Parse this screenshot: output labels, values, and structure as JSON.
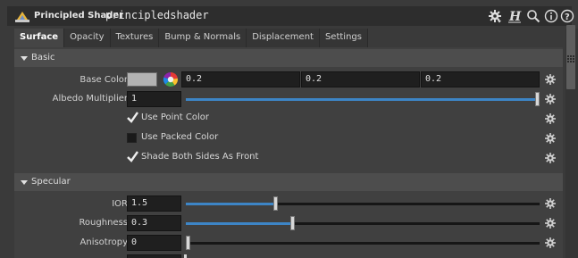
{
  "header": {
    "node_type": "Principled Shader",
    "node_name": "principledshader",
    "icons": [
      "shader-logo-icon",
      "gear-icon",
      "help-h-icon",
      "search-icon",
      "info-icon",
      "question-icon"
    ]
  },
  "tabs": [
    {
      "label": "Surface",
      "active": true
    },
    {
      "label": "Opacity",
      "active": false
    },
    {
      "label": "Textures",
      "active": false
    },
    {
      "label": "Bump & Normals",
      "active": false
    },
    {
      "label": "Displacement",
      "active": false
    },
    {
      "label": "Settings",
      "active": false
    }
  ],
  "basic": {
    "folder_label": "Basic",
    "base_color": {
      "label": "Base Color",
      "swatch_color": "#b3b3b3",
      "r": "0.2",
      "g": "0.2",
      "b": "0.2"
    },
    "albedo": {
      "label": "Albedo Multiplier",
      "value": "1",
      "fraction": 1.0
    },
    "use_point_color": {
      "label": "Use Point Color",
      "checked": true
    },
    "use_packed_color": {
      "label": "Use Packed Color",
      "checked": false
    },
    "shade_both_sides": {
      "label": "Shade Both Sides As Front",
      "checked": true
    }
  },
  "specular": {
    "folder_label": "Specular",
    "ior": {
      "label": "IOR",
      "value": "1.5",
      "fraction": 0.25
    },
    "roughness": {
      "label": "Roughness",
      "value": "0.3",
      "fraction": 0.3
    },
    "anisotropy": {
      "label": "Anisotropy",
      "value": "0",
      "fraction": 0.0
    }
  },
  "colors": {
    "accent": "#3d85c6",
    "panel_bg": "#404040",
    "folder_bg": "#4d4d4d",
    "field_bg": "#1f1f1f"
  }
}
